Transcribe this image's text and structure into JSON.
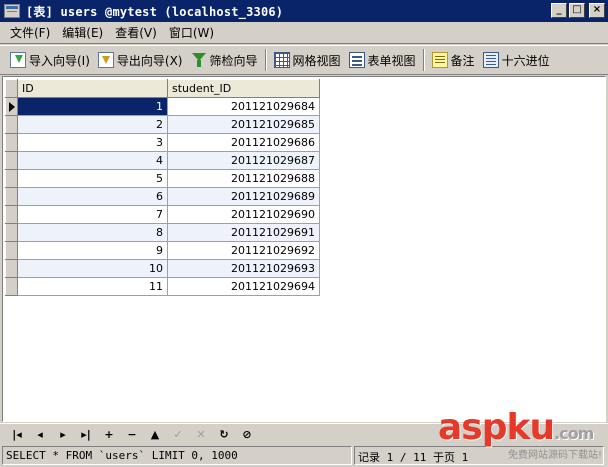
{
  "window": {
    "title": "[表] users @mytest (localhost_3306)",
    "buttons": {
      "minimize": "_",
      "maximize": "□",
      "close": "×"
    }
  },
  "menu": [
    {
      "label": "文件(F)"
    },
    {
      "label": "编辑(E)"
    },
    {
      "label": "查看(V)"
    },
    {
      "label": "窗口(W)"
    }
  ],
  "toolbar": {
    "import_label": "导入向导(I)",
    "export_label": "导出向导(X)",
    "filter_label": "筛检向导",
    "grid_view_label": "网格视图",
    "form_view_label": "表单视图",
    "memo_label": "备注",
    "hex_label": "十六进位"
  },
  "grid": {
    "columns": [
      "ID",
      "student_ID"
    ],
    "rows": [
      {
        "id": "1",
        "student_id": "201121029684"
      },
      {
        "id": "2",
        "student_id": "201121029685"
      },
      {
        "id": "3",
        "student_id": "201121029686"
      },
      {
        "id": "4",
        "student_id": "201121029687"
      },
      {
        "id": "5",
        "student_id": "201121029688"
      },
      {
        "id": "6",
        "student_id": "201121029689"
      },
      {
        "id": "7",
        "student_id": "201121029690"
      },
      {
        "id": "8",
        "student_id": "201121029691"
      },
      {
        "id": "9",
        "student_id": "201121029692"
      },
      {
        "id": "10",
        "student_id": "201121029693"
      },
      {
        "id": "11",
        "student_id": "201121029694"
      }
    ],
    "selected_row": 0
  },
  "navigator": {
    "first": "|◂",
    "prev": "◂",
    "next": "▸",
    "last": "▸|",
    "add": "+",
    "delete": "−",
    "up": "▲",
    "apply": "✓",
    "cancel": "✕",
    "refresh": "↻",
    "stop": "⊘"
  },
  "status": {
    "sql": "SELECT * FROM `users` LIMIT 0, 1000",
    "record": "记录 1 / 11 于页 1"
  },
  "watermark": {
    "main_a": "asp",
    "main_b": "ku",
    "main_c": ".com",
    "sub": "免费网站源码下载站!"
  },
  "colors": {
    "titlebar": "#0a246a",
    "selection": "#0a246a",
    "watermark": "#e8382a"
  }
}
